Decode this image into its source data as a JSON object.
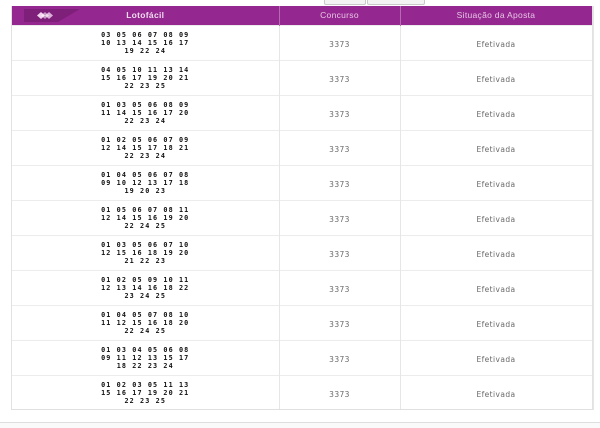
{
  "top_tabs": [
    "",
    ""
  ],
  "header": {
    "col_game": "Lotofácil",
    "col_contest": "Concurso",
    "col_status": "Situação da Aposta"
  },
  "rows": [
    {
      "lines": [
        "03  05  06  07  08  09",
        "10  13  14  15  16  17",
        "19  22  24"
      ],
      "contest": "3373",
      "status": "Efetivada"
    },
    {
      "lines": [
        "04  05  10  11  13  14",
        "15  16  17  19  20  21",
        "22  23  25"
      ],
      "contest": "3373",
      "status": "Efetivada"
    },
    {
      "lines": [
        "01  03  05  06  08  09",
        "11  14  15  16  17  20",
        "22  23  24"
      ],
      "contest": "3373",
      "status": "Efetivada"
    },
    {
      "lines": [
        "01  02  05  06  07  09",
        "12  14  15  17  18  21",
        "22  23  24"
      ],
      "contest": "3373",
      "status": "Efetivada"
    },
    {
      "lines": [
        "01  04  05  06  07  08",
        "09  10  12  13  17  18",
        "19  20  23"
      ],
      "contest": "3373",
      "status": "Efetivada"
    },
    {
      "lines": [
        "01  05  06  07  08  11",
        "12  14  15  16  19  20",
        "22  24  25"
      ],
      "contest": "3373",
      "status": "Efetivada"
    },
    {
      "lines": [
        "01  03  05  06  07  10",
        "12  15  16  18  19  20",
        "21  22  23"
      ],
      "contest": "3373",
      "status": "Efetivada"
    },
    {
      "lines": [
        "01  02  05  09  10  11",
        "12  13  14  16  18  22",
        "23  24  25"
      ],
      "contest": "3373",
      "status": "Efetivada"
    },
    {
      "lines": [
        "01  04  05  07  08  10",
        "11  12  15  16  18  20",
        "22  24  25"
      ],
      "contest": "3373",
      "status": "Efetivada"
    },
    {
      "lines": [
        "01  03  04  05  06  08",
        "09  11  12  13  15  17",
        "18  22  23  24"
      ],
      "contest": "3373",
      "status": "Efetivada"
    },
    {
      "lines": [
        "01  02  03  05  11  13",
        "15  16  17  19  20  21",
        "22  23  25"
      ],
      "contest": "3373",
      "status": "Efetivada"
    }
  ]
}
